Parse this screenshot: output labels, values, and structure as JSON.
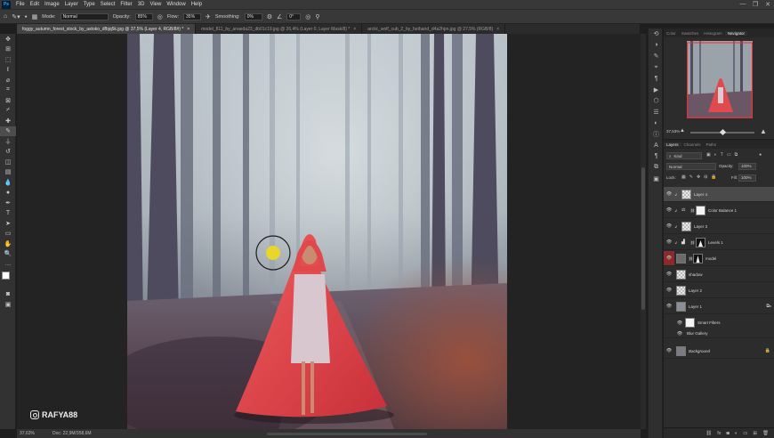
{
  "app": {
    "logo": "Ps"
  },
  "menu": [
    "File",
    "Edit",
    "Image",
    "Layer",
    "Type",
    "Select",
    "Filter",
    "3D",
    "View",
    "Window",
    "Help"
  ],
  "window_controls": [
    "—",
    "❐",
    "✕"
  ],
  "options_bar": {
    "mode_label": "Mode:",
    "mode_value": "Normal",
    "opacity_label": "Opacity:",
    "opacity_value": "85%",
    "flow_label": "Flow:",
    "flow_value": "35%",
    "smoothing_label": "Smoothing:",
    "smoothing_value": "0%",
    "angle_value": "0°"
  },
  "tabs": [
    {
      "label": "foggy_autumn_forest_stock_by_astoko_dfbjq5k.jpg @ 37,5% (Layer 4, RGB/8#) *",
      "active": true
    },
    {
      "label": "model_811_by_anaeda23_db01c19.jpg @ 26,4% (Layer 0, Layer Mask/8) *",
      "active": false
    },
    {
      "label": "arctic_wolf_cub_2_by_furiband_d4a2hpn.jpg @ 27,5% (RGB/8)",
      "active": false
    }
  ],
  "tools": [
    "move",
    "artboard",
    "marquee",
    "lasso",
    "quick-select",
    "crop",
    "frame",
    "eyedropper",
    "healing",
    "brush",
    "stamp",
    "history-brush",
    "eraser",
    "gradient",
    "blur",
    "dodge",
    "pen",
    "type",
    "path-select",
    "shape",
    "hand",
    "zoom"
  ],
  "status": {
    "zoom": "37,63%",
    "doc": "Doc: 22,9M/358,6M"
  },
  "watermark": {
    "handle": "RAFYA88"
  },
  "navigator": {
    "tabs": [
      "Color",
      "Swatches",
      "Histogram",
      "Navigator"
    ],
    "active": "Navigator",
    "zoom": "37,53%"
  },
  "layers_panel": {
    "tabs": [
      "Layers",
      "Channels",
      "Paths"
    ],
    "active": "Layers",
    "filter_kind": "Kind",
    "blend_mode": "Normal",
    "opacity_label": "Opacity:",
    "opacity": "100%",
    "lock_label": "Lock:",
    "fill_label": "Fill:",
    "fill": "100%",
    "layers": [
      {
        "name": "Layer 4",
        "type": "pixel",
        "selected": true,
        "clipped": true
      },
      {
        "name": "Color Balance 1",
        "type": "adjust",
        "clipped": true
      },
      {
        "name": "Layer 3",
        "type": "pixel",
        "clipped": true
      },
      {
        "name": "Levels 1",
        "type": "adjust",
        "clipped": true
      },
      {
        "name": "model",
        "type": "masked",
        "visibility_red": true
      },
      {
        "name": "shadow",
        "type": "pixel"
      },
      {
        "name": "Layer 2",
        "type": "pixel"
      },
      {
        "name": "Layer 1",
        "type": "smart"
      },
      {
        "name": "Smart Filters",
        "type": "filter-group"
      },
      {
        "name": "Blur Gallery",
        "type": "filter"
      },
      {
        "name": "Background",
        "type": "bg"
      }
    ]
  }
}
